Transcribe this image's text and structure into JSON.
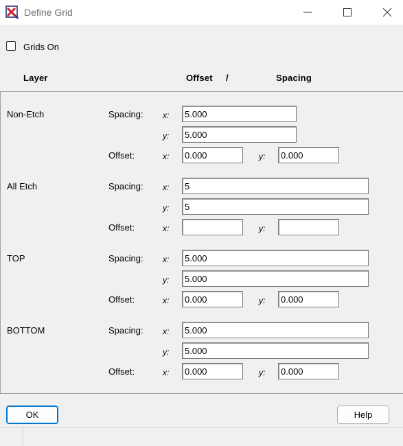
{
  "window": {
    "title": "Define Grid"
  },
  "grids_on": {
    "label": "Grids On",
    "checked": false
  },
  "headers": {
    "layer": "Layer",
    "offset": "Offset",
    "slash": "/",
    "spacing": "Spacing"
  },
  "labels": {
    "spacing": "Spacing:",
    "offset": "Offset:",
    "x": "x:",
    "y": "y:"
  },
  "layers": [
    {
      "name": "Non-Etch",
      "spacing_x": "5.000",
      "spacing_y": "5.000",
      "offset_x": "0.000",
      "offset_y": "0.000"
    },
    {
      "name": "All Etch",
      "spacing_x": "5",
      "spacing_y": "5",
      "offset_x": "",
      "offset_y": ""
    },
    {
      "name": "TOP",
      "spacing_x": "5.000",
      "spacing_y": "5.000",
      "offset_x": "0.000",
      "offset_y": "0.000"
    },
    {
      "name": "BOTTOM",
      "spacing_x": "5.000",
      "spacing_y": "5.000",
      "offset_x": "0.000",
      "offset_y": "0.000"
    }
  ],
  "buttons": {
    "ok": "OK",
    "help": "Help"
  }
}
